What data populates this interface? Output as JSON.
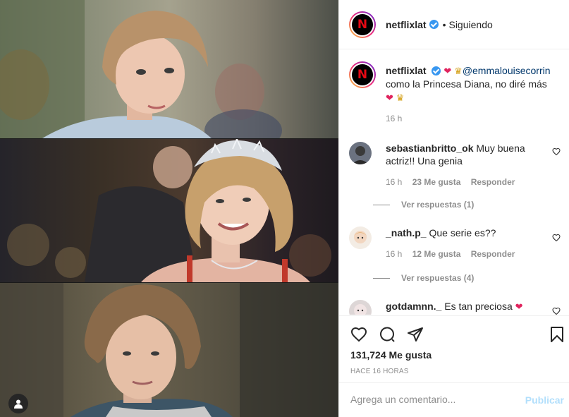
{
  "header": {
    "account": "netflixlat",
    "follow_status": "Siguiendo",
    "separator": "•",
    "avatar_letter": "N"
  },
  "caption": {
    "username": "netflixlat",
    "mention": "@emmalouisecorrin",
    "text": "como la Princesa Diana, no diré más",
    "emoji_heart": "❤",
    "emoji_crown": "♛",
    "time": "16 h"
  },
  "comments": [
    {
      "username": "sebastianbritto_ok",
      "text": "Muy buena actriz!! Una genia",
      "time": "16 h",
      "likes": "23 Me gusta",
      "reply_label": "Responder",
      "view_replies": "Ver respuestas (1)"
    },
    {
      "username": "_nath.p_",
      "text": "Que serie es??",
      "time": "16 h",
      "likes": "12 Me gusta",
      "reply_label": "Responder",
      "view_replies": "Ver respuestas (4)"
    },
    {
      "username": "gotdamnn._",
      "text": "Es tan preciosa",
      "emoji": "❤"
    }
  ],
  "actions": {
    "like_count": "131,724 Me gusta",
    "posted_ago": "HACE 16 HORAS"
  },
  "composer": {
    "placeholder": "Agrega un comentario...",
    "publish_label": "Publicar"
  },
  "colors": {
    "netflix_red": "#e50914",
    "verified_blue": "#3897f0",
    "mention_blue": "#00376b",
    "publish_disabled": "#b2dffc",
    "muted_text": "#8e8e8e"
  }
}
